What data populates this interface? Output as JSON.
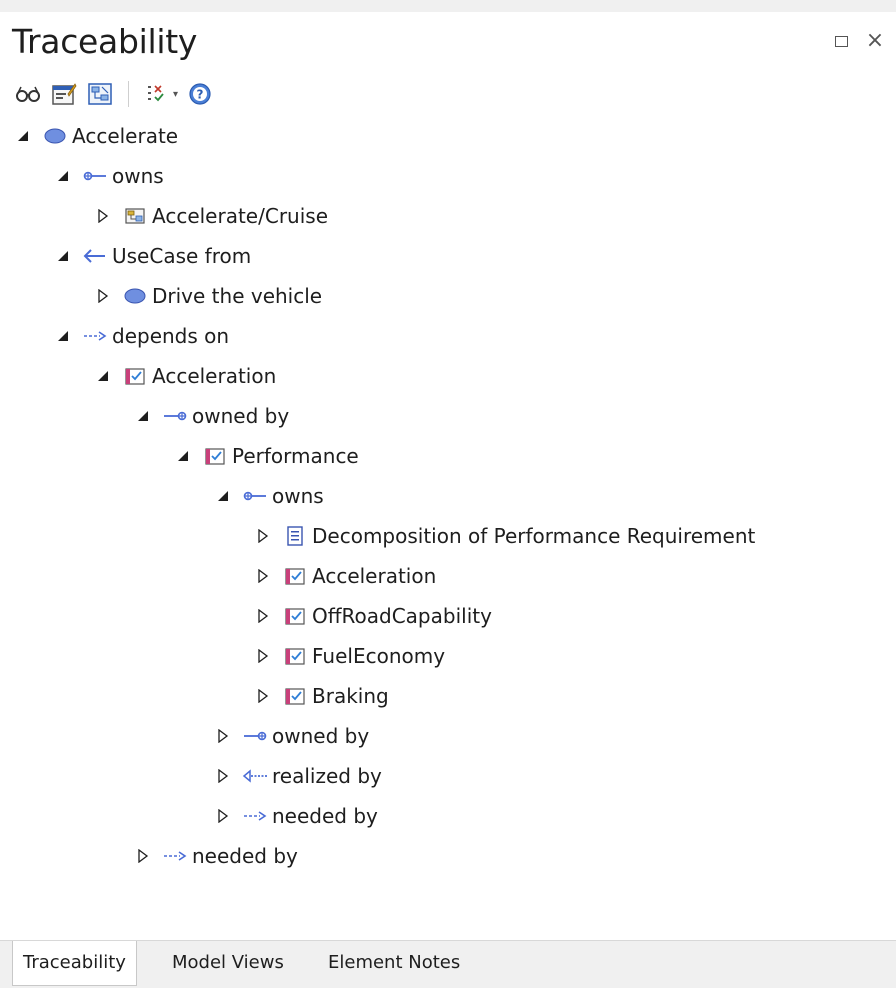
{
  "window": {
    "title": "Traceability",
    "maximize_label": "",
    "close_label": "×"
  },
  "toolbar": {
    "buttons": [
      "glasses-icon",
      "properties-icon",
      "diagram-icon",
      "filter-icon",
      "help-icon"
    ]
  },
  "colors": {
    "usecase_fill": "#6f8fe0",
    "connector_blue": "#4a6cd6",
    "requirement_pink": "#c8407a"
  },
  "tree": [
    {
      "label": "Accelerate",
      "icon": "usecase-ellipse-icon",
      "expanded": true
    },
    {
      "label": "owns",
      "icon": "owns-connector-icon",
      "expanded": true
    },
    {
      "label": "Accelerate/Cruise",
      "icon": "activity-diagram-icon",
      "expanded": false
    },
    {
      "label": "UseCase from",
      "icon": "arrow-left-icon",
      "expanded": true
    },
    {
      "label": "Drive the vehicle",
      "icon": "usecase-ellipse-icon",
      "expanded": false
    },
    {
      "label": "depends on",
      "icon": "dependency-arrow-icon",
      "expanded": true
    },
    {
      "label": "Acceleration",
      "icon": "requirement-icon",
      "expanded": true
    },
    {
      "label": "owned by",
      "icon": "owned-by-connector-icon",
      "expanded": true
    },
    {
      "label": "Performance",
      "icon": "requirement-icon",
      "expanded": true
    },
    {
      "label": "owns",
      "icon": "owns-connector-icon",
      "expanded": true
    },
    {
      "label": "Decomposition of Performance Requirement",
      "icon": "document-icon",
      "expanded": false
    },
    {
      "label": "Acceleration",
      "icon": "requirement-icon",
      "expanded": false
    },
    {
      "label": "OffRoadCapability",
      "icon": "requirement-icon",
      "expanded": false
    },
    {
      "label": "FuelEconomy",
      "icon": "requirement-icon",
      "expanded": false
    },
    {
      "label": "Braking",
      "icon": "requirement-icon",
      "expanded": false
    },
    {
      "label": "owned by",
      "icon": "owned-by-connector-icon",
      "expanded": false
    },
    {
      "label": "realized by",
      "icon": "realization-arrow-icon",
      "expanded": false
    },
    {
      "label": "needed by",
      "icon": "dependency-arrow-icon",
      "expanded": false
    },
    {
      "label": "needed by",
      "icon": "dependency-arrow-icon",
      "expanded": false
    }
  ],
  "tabs": [
    {
      "label": "Traceability",
      "active": true
    },
    {
      "label": "Model Views",
      "active": false
    },
    {
      "label": "Element Notes",
      "active": false
    }
  ]
}
